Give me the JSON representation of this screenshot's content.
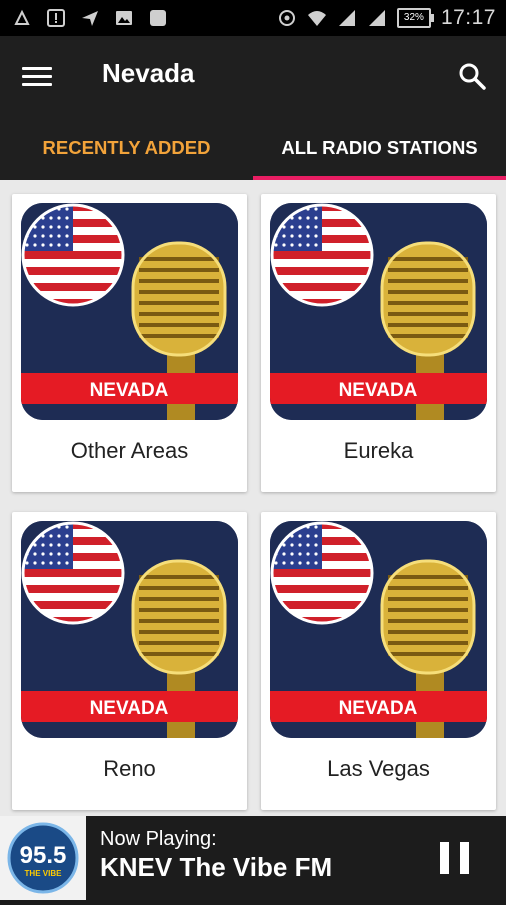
{
  "status_bar": {
    "time": "17:17",
    "battery": "32%",
    "icons": [
      "usb-icon",
      "alert-icon",
      "send-icon",
      "image-icon",
      "square-icon",
      "sync-icon",
      "wifi-icon",
      "signal-icon",
      "signal-icon-2",
      "battery-icon"
    ]
  },
  "app_bar": {
    "title": "Nevada",
    "menu_icon": "hamburger-menu-icon",
    "search_icon": "search-icon"
  },
  "tabs": [
    {
      "label": "RECENTLY ADDED",
      "active": false,
      "color": "#f2a33a"
    },
    {
      "label": "ALL RADIO STATIONS",
      "active": true,
      "indicator_color": "#e91e63"
    }
  ],
  "stations": [
    {
      "name": "Other Areas",
      "banner": "NEVADA"
    },
    {
      "name": "Eureka",
      "banner": "NEVADA"
    },
    {
      "name": "Reno",
      "banner": "NEVADA"
    },
    {
      "name": "Las Vegas",
      "banner": "NEVADA"
    }
  ],
  "player": {
    "now_playing_label": "Now Playing:",
    "station": "KNEV The Vibe FM",
    "logo_text": "95.5",
    "logo_subtext": "THE VIBE",
    "pause_icon": "pause-icon"
  }
}
